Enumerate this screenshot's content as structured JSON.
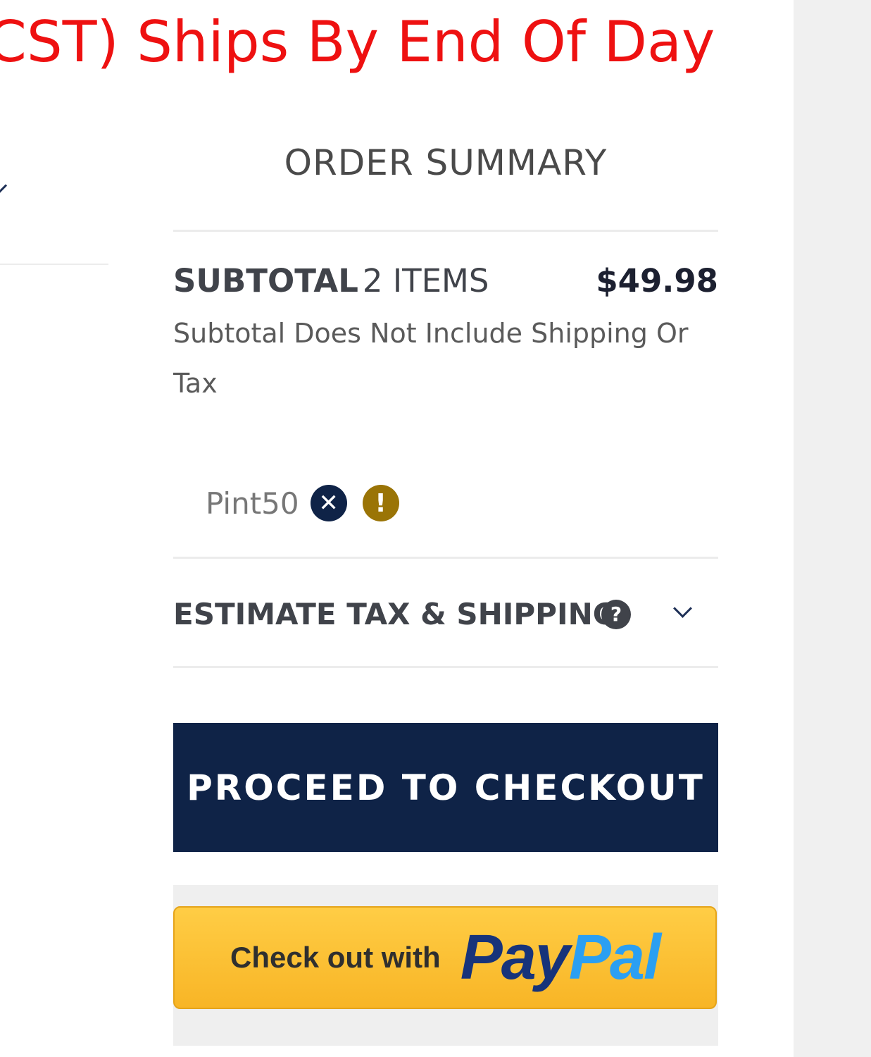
{
  "banner": {
    "text": "CST) Ships By End Of Day",
    "color": "#ee1111"
  },
  "order_summary": {
    "title": "ORDER SUMMARY",
    "subtotal": {
      "label": "SUBTOTAL",
      "item_count": "2 ITEMS",
      "amount": "$49.98",
      "note": "Subtotal Does Not Include Shipping Or Tax"
    },
    "coupon": {
      "code": "Pint50",
      "remove_icon": "close-circle-icon",
      "status_icon": "exclamation-circle-icon",
      "status_color": "#9a7406"
    },
    "estimate": {
      "label": "ESTIMATE TAX & SHIPPING",
      "help_icon": "question-circle-icon",
      "expand_icon": "chevron-down-icon"
    },
    "checkout_button": {
      "label": "PROCEED TO CHECKOUT",
      "color": "#0f2347"
    },
    "paypal_button": {
      "prefix": "Check out with",
      "brand_pay": "Pay",
      "brand_pal": "Pal",
      "color": "#ffc439"
    }
  }
}
